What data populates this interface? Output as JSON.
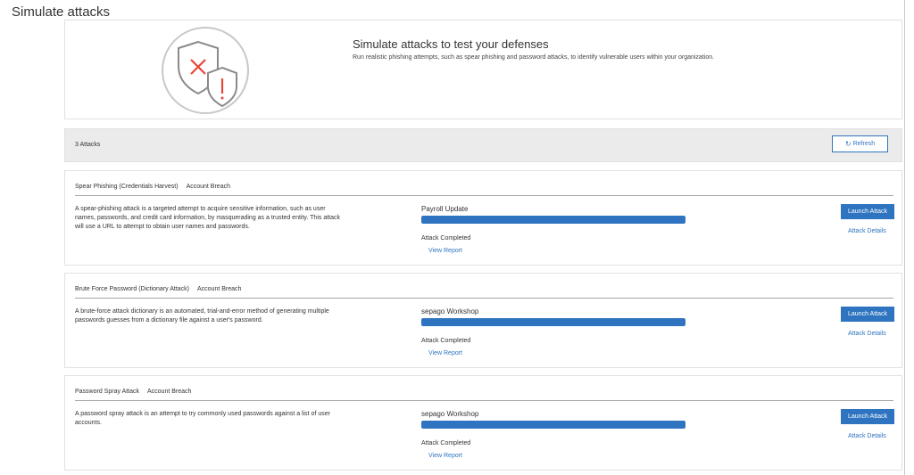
{
  "page": {
    "title": "Simulate attacks"
  },
  "hero": {
    "title": "Simulate attacks to test your defenses",
    "subtitle": "Run realistic phishing attempts, such as spear phishing and password attacks, to identify vulnerable users within your organization."
  },
  "toolbar": {
    "count_label": "3 Attacks",
    "refresh_label": "Refresh"
  },
  "colors": {
    "accent": "#2e74c0",
    "icon_red": "#e8463a",
    "icon_gray": "#8a8a8a"
  },
  "attacks": [
    {
      "name": "Spear Phishing (Credentials Harvest)",
      "category": "Account Breach",
      "description": "A spear-phishing attack is a targeted attempt to acquire sensitive information, such as user names, passwords, and credit card information, by masquerading as a trusted entity. This attack will use a URL to attempt to obtain user names and passwords.",
      "campaign": "Payroll Update",
      "progress": 1.0,
      "status": "Attack Completed",
      "view_report": "View Report",
      "launch_label": "Launch Attack",
      "details_label": "Attack Details"
    },
    {
      "name": "Brute Force Password (Dictionary Attack)",
      "category": "Account Breach",
      "description": "A brute-force attack dictionary is an automated, trial-and-error method of generating multiple passwords guesses from a dictionary file against a user's password.",
      "campaign": "sepago Workshop",
      "progress": 1.0,
      "status": "Attack Completed",
      "view_report": "View Report",
      "launch_label": "Launch Attack",
      "details_label": "Attack Details"
    },
    {
      "name": "Password Spray Attack",
      "category": "Account Breach",
      "description": "A password spray attack is an attempt to try commonly used passwords against a list of user accounts.",
      "campaign": "sepago Workshop",
      "progress": 1.0,
      "status": "Attack Completed",
      "view_report": "View Report",
      "launch_label": "Launch Attack",
      "details_label": "Attack Details"
    }
  ]
}
